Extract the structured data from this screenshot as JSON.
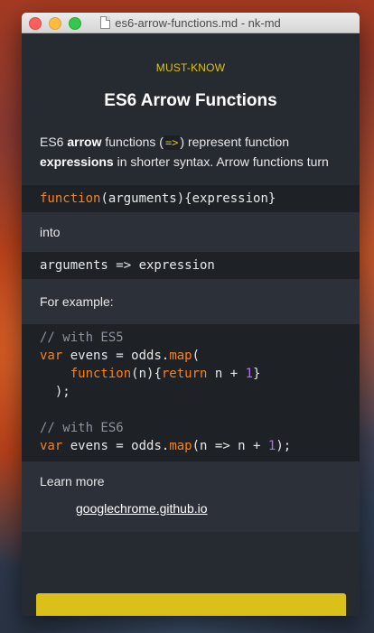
{
  "window": {
    "title": "es6-arrow-functions.md - nk-md"
  },
  "card": {
    "tag": "MUST-KNOW",
    "title": "ES6 Arrow Functions",
    "intro": {
      "p1": "ES6 ",
      "b1": "arrow",
      "p2": " functions (",
      "code": "=>",
      "p3": ") represent function ",
      "b2": "expressions",
      "p4": " in shorter syntax. Arrow functions turn"
    },
    "code1": {
      "kw": "function",
      "rest": "(arguments){expression}"
    },
    "into_label": "into",
    "code2": "arguments => expression",
    "example_label": "For example:",
    "example": {
      "c1": "// with ES5",
      "l2_kw": "var",
      "l2_a": " evens = odds.",
      "l2_fn": "map",
      "l2_b": "(",
      "l3_indent": "    ",
      "l3_kw": "function",
      "l3_a": "(n){",
      "l3_kw2": "return",
      "l3_b": " n + ",
      "l3_num": "1",
      "l3_c": "}",
      "l4": "  );",
      "c2": "// with ES6",
      "l7_kw": "var",
      "l7_a": " evens = odds.",
      "l7_fn": "map",
      "l7_b": "(n => n + ",
      "l7_num": "1",
      "l7_c": ");"
    },
    "learn_more": "Learn more",
    "link": "googlechrome.github.io"
  },
  "colors": {
    "accent": "#dcc01a",
    "keyword": "#f5831f",
    "number": "#b072e6",
    "background": "#262a31"
  }
}
